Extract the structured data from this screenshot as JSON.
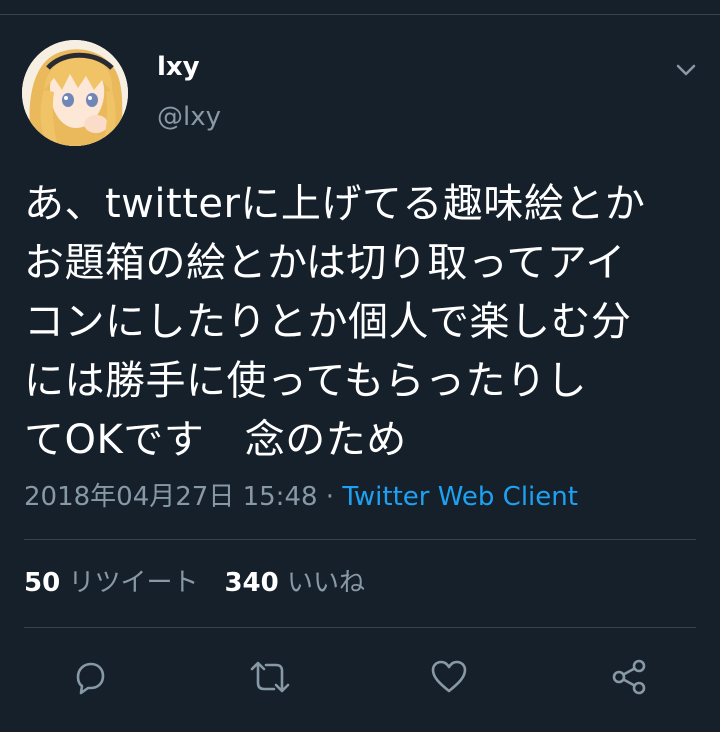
{
  "author": {
    "display_name": "lxy",
    "handle": "@lxy",
    "avatar_icon": "avatar-anime-girl"
  },
  "tweet": {
    "text": "あ、twitterに上げてる趣味絵とか\nお題箱の絵とかは切り取ってアイ\nコンにしたりとか個人で楽しむ分\nには勝手に使ってもらったりし\nてOKです　念のため",
    "timestamp": "2018年04月27日 15:48",
    "separator": " · ",
    "client": "Twitter Web Client"
  },
  "stats": {
    "retweets_count": "50",
    "retweets_label": "リツイート",
    "likes_count": "340",
    "likes_label": "いいね"
  },
  "actions": {
    "icons": [
      "reply-icon",
      "retweet-icon",
      "like-icon",
      "share-icon"
    ]
  },
  "colors": {
    "background": "#15202b",
    "secondary_text": "#8899a6",
    "link": "#1da1f2",
    "divider": "#38444d"
  }
}
